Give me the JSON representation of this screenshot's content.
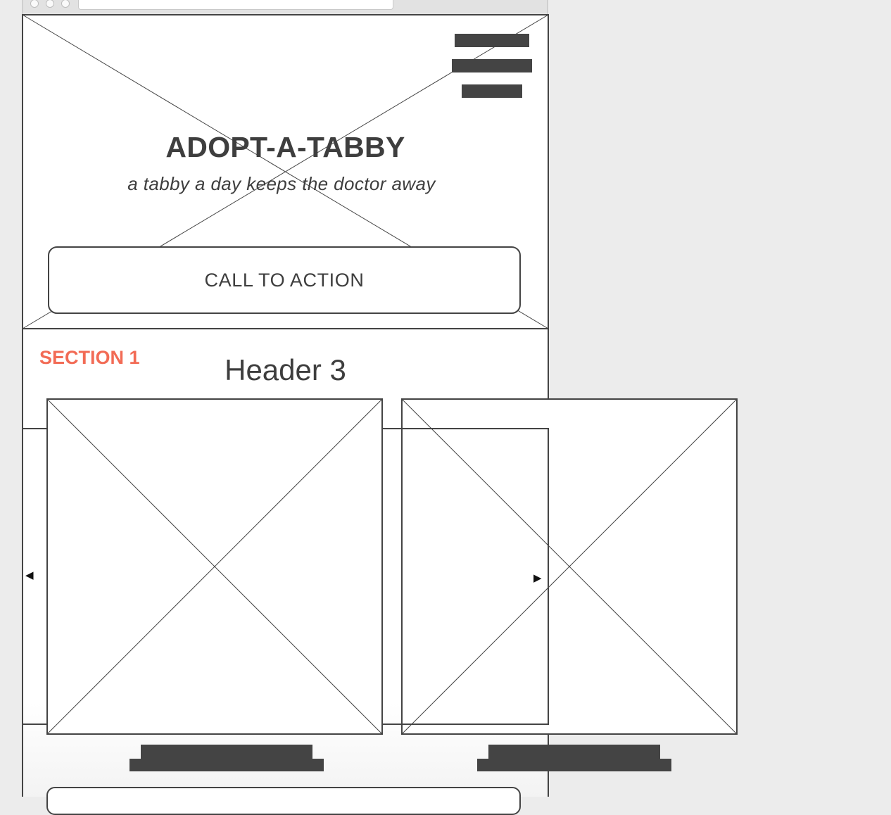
{
  "hero": {
    "title": "ADOPT-A-TABBY",
    "tagline": "a tabby a day keeps the doctor away",
    "cta_label": "CALL TO ACTION"
  },
  "section1": {
    "label": "SECTION 1",
    "header": "Header 3",
    "carousel": {
      "prev_glyph": "◀",
      "next_glyph": "▶"
    }
  },
  "icons": {
    "menu": "hamburger-menu-icon",
    "image_placeholder": "image-placeholder-icon",
    "prev": "prev-arrow-icon",
    "next": "next-arrow-icon"
  },
  "colors": {
    "accent": "#f26b55",
    "ink": "#444444",
    "background": "#ececec"
  }
}
